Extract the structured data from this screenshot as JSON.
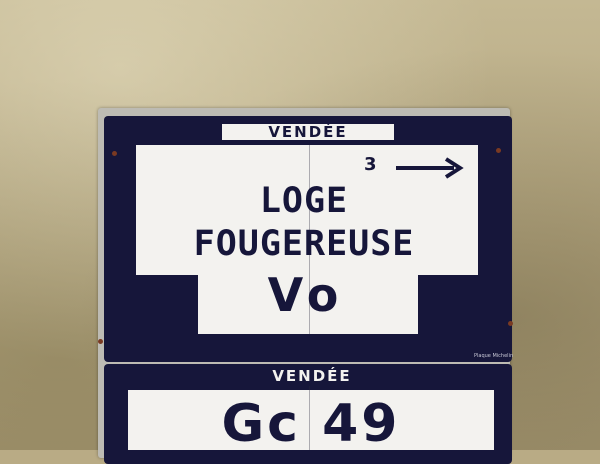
{
  "sign": {
    "region_top": "VENDÉE",
    "place_line1": "LOGE",
    "place_line2": "FOUGEREUSE",
    "hamlet": "Vo",
    "distance": "3",
    "region_bottom": "VENDÉE",
    "route_number": "Gc 49",
    "maker": "Plaque Michelin"
  },
  "colors": {
    "enamel_blue": "#16163a",
    "enamel_white": "#f3f2ef",
    "wall": "#b9ab85"
  },
  "icons": [
    "right-arrow-icon"
  ]
}
